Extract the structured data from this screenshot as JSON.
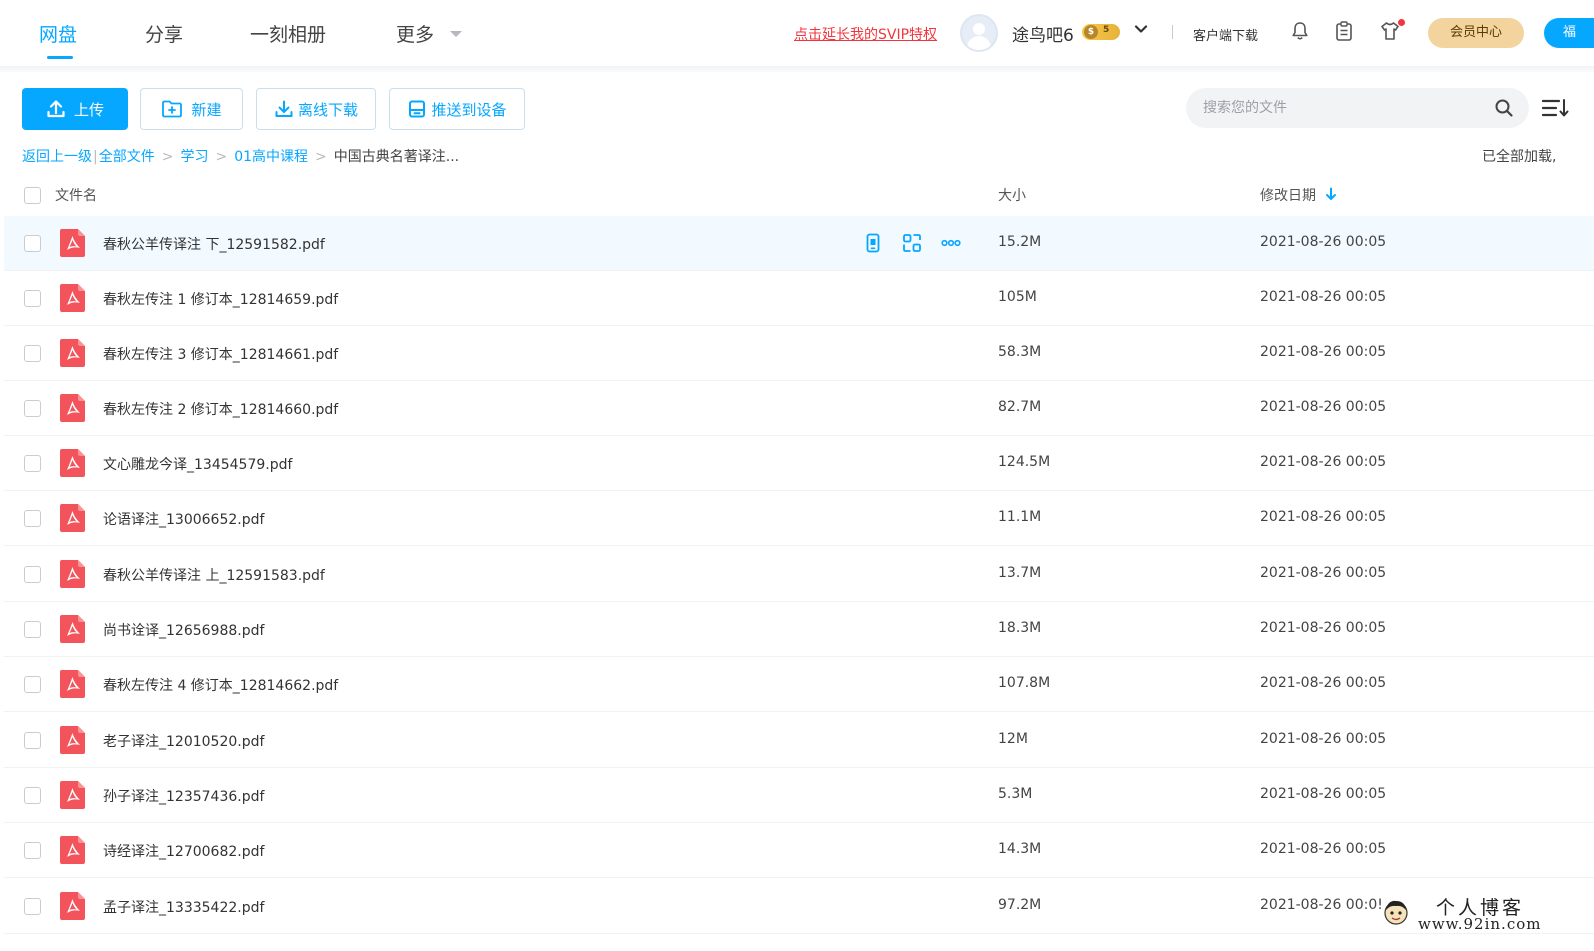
{
  "header": {
    "nav": [
      {
        "label": "网盘",
        "active": true
      },
      {
        "label": "分享",
        "active": false
      },
      {
        "label": "一刻相册",
        "active": false
      },
      {
        "label": "更多",
        "active": false
      }
    ],
    "svip_promo": "点击延长我的SVIP特权",
    "username": "途鸟吧6",
    "badge_left": "$",
    "badge_level": "5",
    "client_download": "客户端下载",
    "member_center": "会员中心",
    "cut_button_text": "福",
    "icons": [
      "bell-icon",
      "clipboard-icon",
      "shirt-icon"
    ]
  },
  "toolbar": {
    "upload": "上传",
    "new": "新建",
    "offline_download": "离线下载",
    "push_to_device": "推送到设备",
    "search_placeholder": "搜索您的文件"
  },
  "breadcrumb": {
    "back": "返回上一级",
    "separator": "|",
    "items": [
      "全部文件",
      "学习",
      "01高中课程"
    ],
    "current": "中国古典名著译注..."
  },
  "status_text": "已全部加载,",
  "table": {
    "headers": {
      "name": "文件名",
      "size": "大小",
      "date": "修改日期"
    },
    "sort": {
      "column": "date",
      "direction": "desc"
    },
    "rows": [
      {
        "name": "春秋公羊传译注 下_12591582.pdf",
        "size": "15.2M",
        "date": "2021-08-26 00:05"
      },
      {
        "name": "春秋左传注 1 修订本_12814659.pdf",
        "size": "105M",
        "date": "2021-08-26 00:05"
      },
      {
        "name": "春秋左传注 3 修订本_12814661.pdf",
        "size": "58.3M",
        "date": "2021-08-26 00:05"
      },
      {
        "name": "春秋左传注 2 修订本_12814660.pdf",
        "size": "82.7M",
        "date": "2021-08-26 00:05"
      },
      {
        "name": "文心雕龙今译_13454579.pdf",
        "size": "124.5M",
        "date": "2021-08-26 00:05"
      },
      {
        "name": "论语译注_13006652.pdf",
        "size": "11.1M",
        "date": "2021-08-26 00:05"
      },
      {
        "name": "春秋公羊传译注 上_12591583.pdf",
        "size": "13.7M",
        "date": "2021-08-26 00:05"
      },
      {
        "name": "尚书诠译_12656988.pdf",
        "size": "18.3M",
        "date": "2021-08-26 00:05"
      },
      {
        "name": "春秋左传注 4 修订本_12814662.pdf",
        "size": "107.8M",
        "date": "2021-08-26 00:05"
      },
      {
        "name": "老子译注_12010520.pdf",
        "size": "12M",
        "date": "2021-08-26 00:05"
      },
      {
        "name": "孙子译注_12357436.pdf",
        "size": "5.3M",
        "date": "2021-08-26 00:05"
      },
      {
        "name": "诗经译注_12700682.pdf",
        "size": "14.3M",
        "date": "2021-08-26 00:05"
      },
      {
        "name": "孟子译注_13335422.pdf",
        "size": "97.2M",
        "date": "2021-08-26 00:0!"
      }
    ]
  },
  "watermark": {
    "title": "个人博客",
    "url": "www.92in.com"
  },
  "colors": {
    "accent": "#06a7ff",
    "promo": "#f3353d",
    "member_gold": "#f3d49e",
    "pdf_red": "#f3545b",
    "row_hover": "#f2f9ff"
  }
}
